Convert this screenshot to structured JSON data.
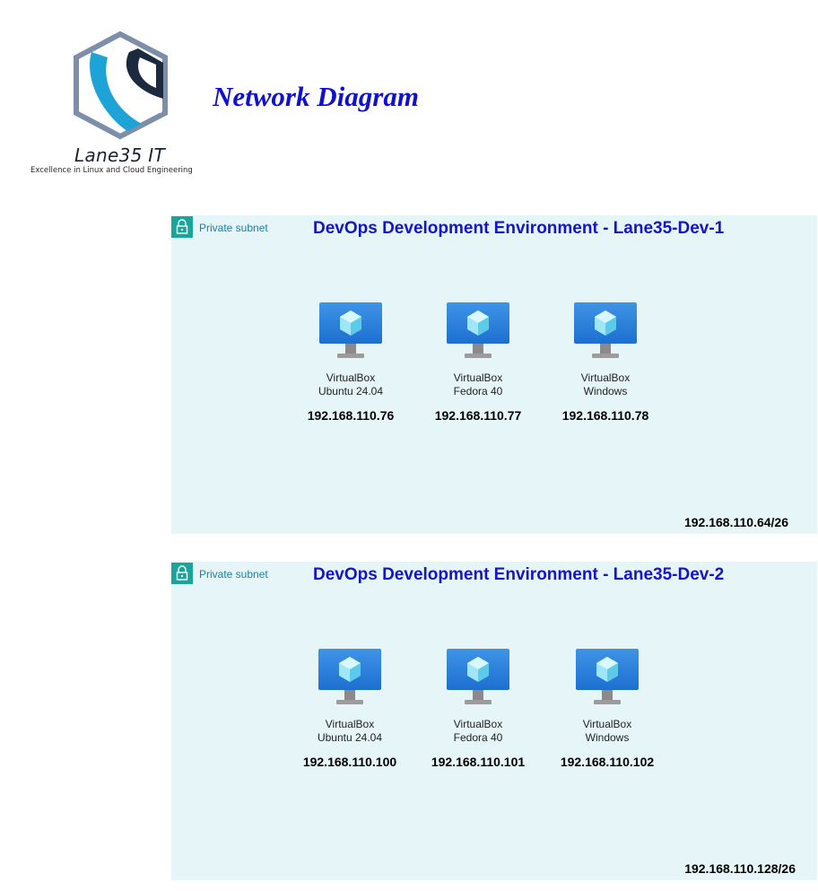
{
  "logo": {
    "name": "Lane35 IT",
    "tagline": "Excellence in Linux and Cloud Engineering"
  },
  "title": "Network Diagram",
  "colors": {
    "title": "#1010d0",
    "env_title": "#1414c8",
    "subnet_bg": "#e6f5f7",
    "subnet_label": "#1c7fa3",
    "lock": "#1aa59c",
    "monitor": "#2b7fd8"
  },
  "subnets": [
    {
      "label": "Private subnet",
      "icon": "lock-icon",
      "title": "DevOps Development Environment - Lane35-Dev-1",
      "cidr": "192.168.110.64/26",
      "vms": [
        {
          "line1": "VirtualBox",
          "line2": "Ubuntu 24.04",
          "ip": "192.168.110.76",
          "icon": "virtual-machine-icon"
        },
        {
          "line1": "VirtualBox",
          "line2": "Fedora 40",
          "ip": "192.168.110.77",
          "icon": "virtual-machine-icon"
        },
        {
          "line1": "VirtualBox",
          "line2": "Windows",
          "ip": "192.168.110.78",
          "icon": "virtual-machine-icon"
        }
      ]
    },
    {
      "label": "Private subnet",
      "icon": "lock-icon",
      "title": "DevOps Development Environment - Lane35-Dev-2",
      "cidr": "192.168.110.128/26",
      "vms": [
        {
          "line1": "VirtualBox",
          "line2": "Ubuntu 24.04",
          "ip": "192.168.110.100",
          "icon": "virtual-machine-icon"
        },
        {
          "line1": "VirtualBox",
          "line2": "Fedora 40",
          "ip": "192.168.110.101",
          "icon": "virtual-machine-icon"
        },
        {
          "line1": "VirtualBox",
          "line2": "Windows",
          "ip": "192.168.110.102",
          "icon": "virtual-machine-icon"
        }
      ]
    }
  ]
}
